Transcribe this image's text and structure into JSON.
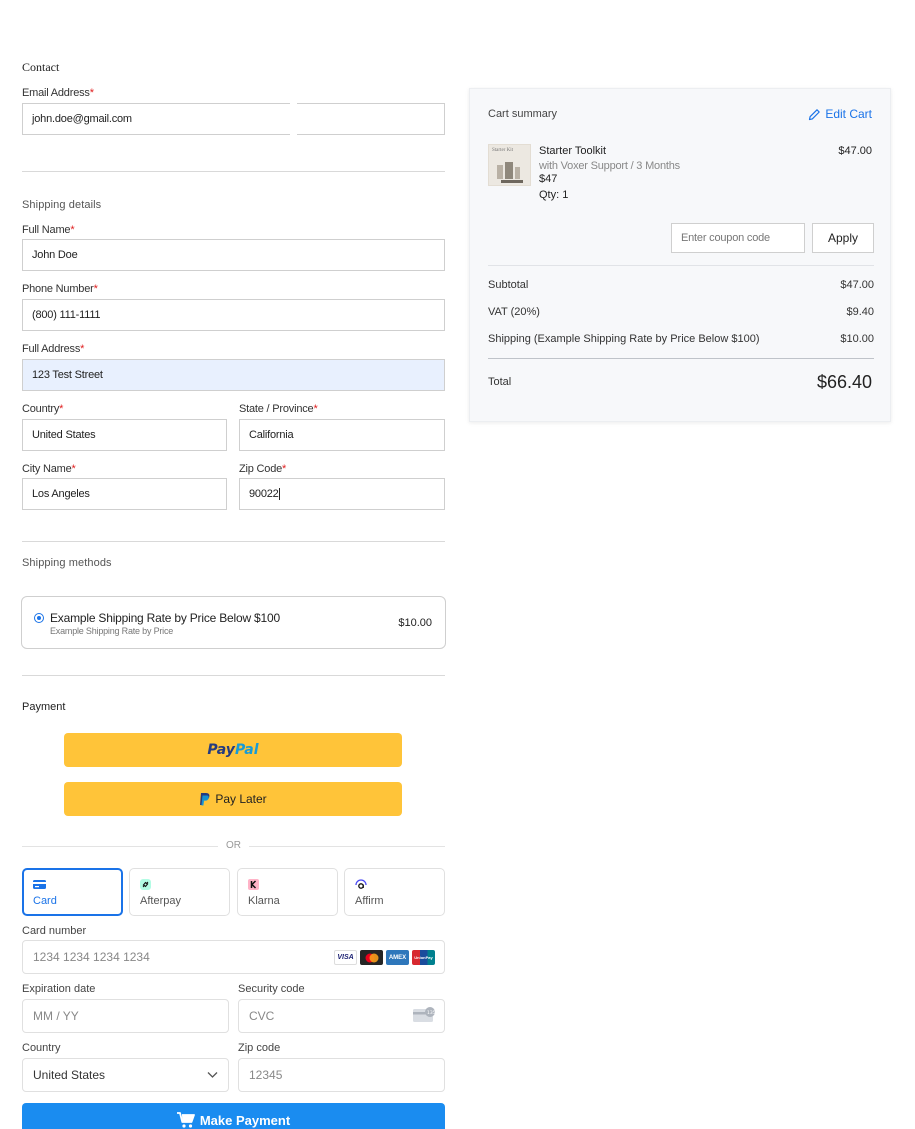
{
  "contact": {
    "title": "Contact",
    "email_label": "Email Address",
    "email_value": "john.doe@gmail.com"
  },
  "shipping_details": {
    "title": "Shipping details",
    "full_name_label": "Full Name",
    "full_name_value": "John Doe",
    "phone_label": "Phone Number",
    "phone_value": "(800) 111-1111",
    "address_label": "Full Address",
    "address_value": "123 Test Street",
    "country_label": "Country",
    "country_value": "United States",
    "state_label": "State / Province",
    "state_value": "California",
    "city_label": "City Name",
    "city_value": "Los Angeles",
    "zip_label": "Zip Code",
    "zip_value": "90022",
    "required_mark": "*"
  },
  "shipping_methods": {
    "title": "Shipping methods",
    "option_name": "Example Shipping Rate by Price Below $100",
    "option_sub": "Example Shipping Rate by Price",
    "option_price": "$10.00"
  },
  "payment": {
    "title": "Payment",
    "paypal_a": "Pay",
    "paypal_b": "Pal",
    "pay_later": "Pay Later",
    "or": "OR",
    "tabs": [
      {
        "label": "Card"
      },
      {
        "label": "Afterpay"
      },
      {
        "label": "Klarna"
      },
      {
        "label": "Affirm"
      }
    ],
    "card_number_label": "Card number",
    "card_number_placeholder": "1234 1234 1234 1234",
    "brands": [
      "VISA",
      "MC",
      "AMEX",
      "UnionPay"
    ],
    "expiry_label": "Expiration date",
    "expiry_placeholder": "MM / YY",
    "cvc_label": "Security code",
    "cvc_placeholder": "CVC",
    "country_label": "Country",
    "country_value": "United States",
    "zip_label": "Zip code",
    "zip_placeholder": "12345",
    "submit_label": "Make Payment"
  },
  "cart": {
    "title": "Cart summary",
    "edit_label": "Edit Cart",
    "item": {
      "thumb_text": "Starter Kit",
      "name": "Starter Toolkit",
      "variant": "with Voxer Support / 3 Months",
      "price": "$47",
      "qty": "Qty: 1",
      "amount": "$47.00"
    },
    "coupon_placeholder": "Enter coupon code",
    "apply_label": "Apply",
    "subtotal_label": "Subtotal",
    "subtotal_value": "$47.00",
    "vat_label": "VAT (20%)",
    "vat_value": "$9.40",
    "shipping_label": "Shipping (Example Shipping Rate by Price Below $100)",
    "shipping_value": "$10.00",
    "total_label": "Total",
    "total_value": "$66.40"
  },
  "colors": {
    "accent": "#1a73e8",
    "paypal_yellow": "#ffc439",
    "pay_button": "#1a8cf0",
    "required": "#e02020"
  }
}
